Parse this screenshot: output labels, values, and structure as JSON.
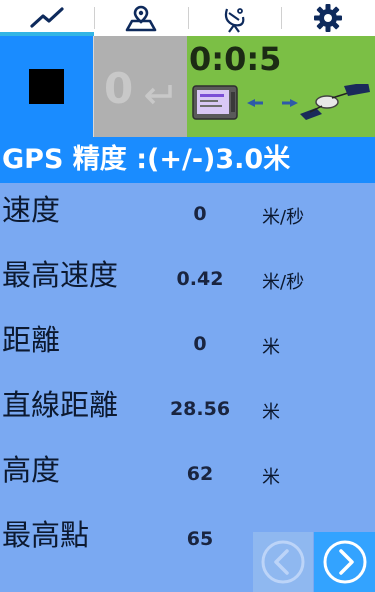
{
  "tabs": [
    {
      "icon": "chart-line-icon",
      "active": true
    },
    {
      "icon": "map-pin-icon",
      "active": false
    },
    {
      "icon": "satellite-dish-icon",
      "active": false
    },
    {
      "icon": "gear-icon",
      "active": false
    }
  ],
  "controls": {
    "lap_count": "0",
    "timer": "0:0:5"
  },
  "gps": {
    "accuracy_label": "GPS 精度 :(+/-)3.0米"
  },
  "stats": [
    {
      "label": "速度",
      "value": "0",
      "unit": "米/秒"
    },
    {
      "label": "最高速度",
      "value": "0.42",
      "unit": "米/秒"
    },
    {
      "label": "距離",
      "value": "0",
      "unit": "米"
    },
    {
      "label": "直線距離",
      "value": "28.56",
      "unit": "米"
    },
    {
      "label": "高度",
      "value": "62",
      "unit": "米"
    },
    {
      "label": "最高點",
      "value": "65",
      "unit": "米"
    }
  ],
  "colors": {
    "accent": "#1a8cff",
    "background": "#7aa9f2",
    "timer_panel": "#7bbf45",
    "tab_indicator": "#33b5e5"
  }
}
